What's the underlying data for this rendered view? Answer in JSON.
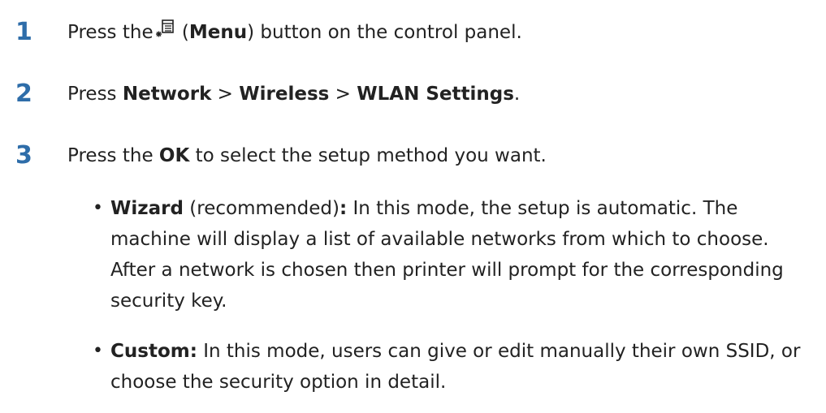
{
  "colors": {
    "step_number": "#2e6da9",
    "text": "#222222"
  },
  "steps": [
    {
      "number": "1",
      "pre": "Press the",
      "icon": "menu-icon",
      "paren_open": " (",
      "bold": "Menu",
      "post": ") button on the control panel."
    },
    {
      "number": "2",
      "pre": "Press ",
      "b1": "Network",
      "sep1": " > ",
      "b2": "Wireless",
      "sep2": " > ",
      "b3": "WLAN Settings",
      "post": "."
    },
    {
      "number": "3",
      "pre": "Press the ",
      "bold": "OK",
      "post": " to select the setup method you want."
    }
  ],
  "bullets": [
    {
      "dot": "•",
      "bold": "Wizard",
      "middle": " (recommended)",
      "colon": ":",
      "text": " In this mode, the setup is automatic. The machine will display a list of available networks from which to choose. After a network is chosen then printer will prompt for the corresponding security key."
    },
    {
      "dot": "•",
      "bold": "Custom:",
      "text": " In this mode, users can give or edit manually their own SSID, or choose the security option in detail."
    }
  ]
}
